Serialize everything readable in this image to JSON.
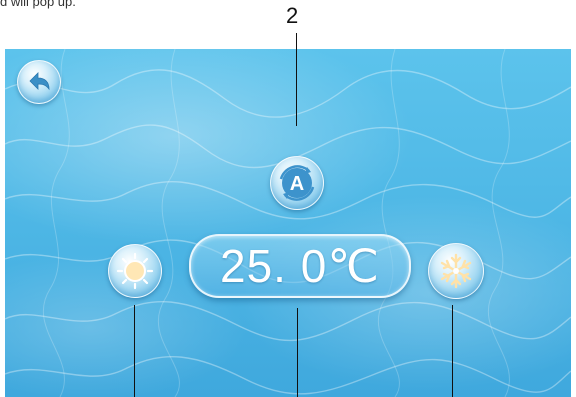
{
  "header": {
    "partial_text": "d will pop up."
  },
  "callouts": {
    "auto_number": "2"
  },
  "screen": {
    "temperature": "25. 0",
    "unit": "℃",
    "icons": {
      "back": "back-arrow-icon",
      "auto": "auto-mode-icon",
      "heat": "sun-icon",
      "cool": "snowflake-icon"
    },
    "auto_letter": "A",
    "colors": {
      "water_top": "#5cc3ec",
      "water_bottom": "#3fa8dd",
      "button_glow": "#ffffff",
      "sun_inner": "#ffd58a"
    }
  }
}
